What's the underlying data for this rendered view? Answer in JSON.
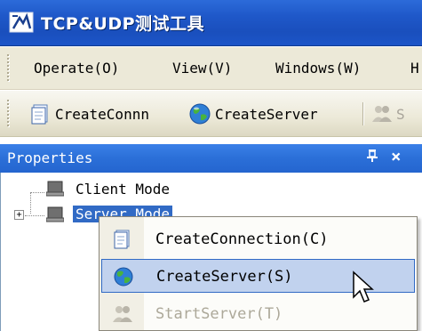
{
  "window": {
    "title": "TCP&UDP测试工具"
  },
  "menubar": {
    "items": [
      {
        "label": "Operate(O)"
      },
      {
        "label": "View(V)"
      },
      {
        "label": "Windows(W)"
      },
      {
        "label": "H"
      }
    ]
  },
  "toolbar": {
    "buttons": [
      {
        "label": "CreateConnn",
        "icon": "document-icon"
      },
      {
        "label": "CreateServer",
        "icon": "globe-icon"
      },
      {
        "label": "S",
        "icon": "users-icon",
        "disabled": true
      }
    ]
  },
  "properties": {
    "title": "Properties",
    "pin": "ꟷ",
    "pin_glyph": "📌",
    "close": "×",
    "tree": [
      {
        "label": "Client Mode"
      },
      {
        "label": "Server Mode",
        "selected": true
      }
    ]
  },
  "context_menu": {
    "items": [
      {
        "label": "CreateConnection(C)",
        "icon": "document-icon"
      },
      {
        "label": "CreateServer(S)",
        "icon": "globe-icon",
        "highlighted": true
      },
      {
        "label": "StartServer(T)",
        "icon": "users-icon",
        "disabled": true
      }
    ]
  },
  "colors": {
    "titlebar": "#1f58c9",
    "panel_header": "#2b6fd8",
    "menu_highlight": "#c1d2ee",
    "selection": "#316ac5"
  }
}
